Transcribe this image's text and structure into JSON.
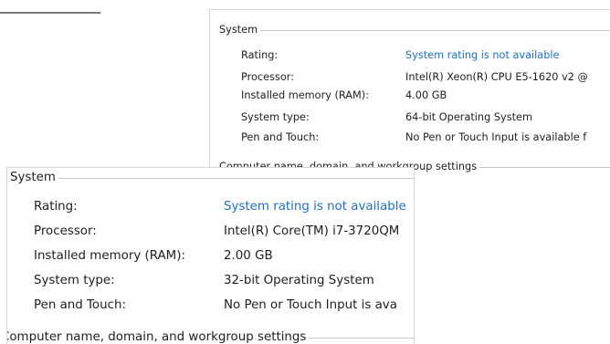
{
  "back_window": {
    "system_heading": "System",
    "properties": [
      {
        "label": "Rating:",
        "value": "System rating is not available",
        "is_link": true
      },
      {
        "label": "Processor:",
        "value": "Intel(R) Xeon(R) CPU E5-1620 v2 @",
        "is_link": false
      },
      {
        "label": "Installed memory (RAM):",
        "value": "4.00 GB",
        "is_link": false
      },
      {
        "label": "System type:",
        "value": "64-bit Operating System",
        "is_link": false
      },
      {
        "label": "Pen and Touch:",
        "value": "No Pen or Touch Input is available f",
        "is_link": false
      }
    ],
    "computer_name_heading": "Computer name, domain, and workgroup settings"
  },
  "front_window": {
    "system_heading": "System",
    "properties": [
      {
        "label": "Rating:",
        "value": "System rating is not available",
        "is_link": true
      },
      {
        "label": "Processor:",
        "value": "Intel(R) Core(TM) i7-3720QM",
        "is_link": false
      },
      {
        "label": "Installed memory (RAM):",
        "value": "2.00 GB",
        "is_link": false
      },
      {
        "label": "System type:",
        "value": "32-bit Operating System",
        "is_link": false
      },
      {
        "label": "Pen and Touch:",
        "value": "No Pen or Touch Input is ava",
        "is_link": false
      }
    ],
    "computer_name_heading": "Computer name, domain, and workgroup settings"
  },
  "colors": {
    "link": "#1f6fba",
    "text": "#1e1e1e",
    "rule": "#c8c8c8"
  }
}
